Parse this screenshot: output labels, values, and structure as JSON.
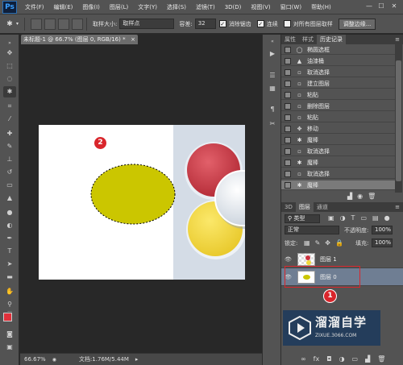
{
  "app": {
    "logo": "Ps"
  },
  "menu": [
    "文件(F)",
    "编辑(E)",
    "图像(I)",
    "图层(L)",
    "文字(Y)",
    "选择(S)",
    "滤镜(T)",
    "3D(D)",
    "视图(V)",
    "窗口(W)",
    "帮助(H)"
  ],
  "window_controls": [
    "—",
    "☐",
    "✕"
  ],
  "options": {
    "sample_size_label": "取样大小:",
    "sample_size_value": "取样点",
    "tolerance_label": "容差:",
    "tolerance_value": "32",
    "antialias_label": "消除锯齿",
    "contiguous_label": "连续",
    "all_layers_label": "对所有图层取样",
    "refine_edge_label": "调整边缘..."
  },
  "document": {
    "tab_title": "未标题-1 @ 66.7% (图层 0, RGB/16) *",
    "zoom": "66.67%",
    "doc_size": "文档:1.76M/5.44M"
  },
  "panel_tabs": [
    "属性",
    "样式",
    "历史记录"
  ],
  "history": [
    {
      "icon": "ellipse-marquee-icon",
      "glyph": "◯",
      "label": "椭圆选框"
    },
    {
      "icon": "paint-bucket-icon",
      "glyph": "▲",
      "label": "油漆桶"
    },
    {
      "icon": "step-icon",
      "glyph": "▫",
      "label": "取消选择"
    },
    {
      "icon": "step-icon",
      "glyph": "▫",
      "label": "建立图层"
    },
    {
      "icon": "step-icon",
      "glyph": "▫",
      "label": "粘贴"
    },
    {
      "icon": "step-icon",
      "glyph": "▫",
      "label": "删除图层"
    },
    {
      "icon": "step-icon",
      "glyph": "▫",
      "label": "粘贴"
    },
    {
      "icon": "move-icon",
      "glyph": "✥",
      "label": "移动"
    },
    {
      "icon": "magic-wand-icon",
      "glyph": "✱",
      "label": "魔棒"
    },
    {
      "icon": "step-icon",
      "glyph": "▫",
      "label": "取消选择"
    },
    {
      "icon": "magic-wand-icon",
      "glyph": "✱",
      "label": "魔棒"
    },
    {
      "icon": "step-icon",
      "glyph": "▫",
      "label": "取消选择"
    },
    {
      "icon": "magic-wand-icon",
      "glyph": "✱",
      "label": "魔棒"
    }
  ],
  "layers_tabs": [
    "3D",
    "图层",
    "通道"
  ],
  "layers": {
    "filter_kind": "类型",
    "blend_mode": "正常",
    "opacity_label": "不透明度:",
    "opacity_value": "100%",
    "lock_label": "锁定:",
    "fill_label": "填充:",
    "fill_value": "100%",
    "items": [
      {
        "name": "图层 1"
      },
      {
        "name": "图层 0"
      }
    ]
  },
  "annotations": {
    "marker_1": "1",
    "marker_2": "2"
  },
  "watermark": {
    "name": "溜溜自学",
    "url": "ZIXUE.3066.COM"
  },
  "colors": {
    "foreground": "#e0303a",
    "background": "#111111",
    "selection_fill": "#cbc600",
    "circle_red": "#cc3340",
    "circle_yellow": "#f0d93a"
  }
}
